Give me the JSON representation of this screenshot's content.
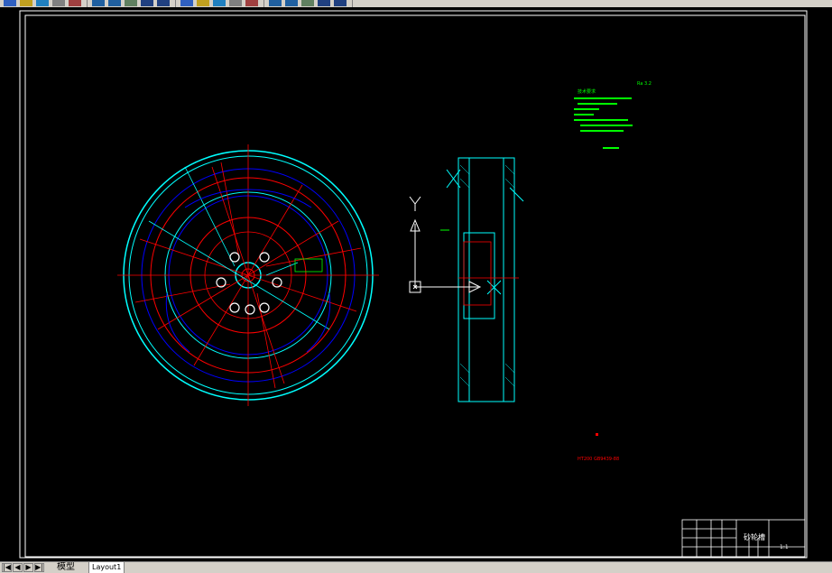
{
  "toolbar": {
    "buttons": [
      "qnew-icon",
      "open-icon",
      "save-icon",
      "print-icon",
      "preview-icon",
      "undo-icon",
      "redo-icon",
      "pan-icon",
      "zoom-icon",
      "zoom-window-icon",
      "zoom-previous-icon",
      "properties-icon",
      "design-center-icon",
      "tool-palettes-icon",
      "sheet-set-icon",
      "markup-icon",
      "calc-icon",
      "layer-icon",
      "color-icon",
      "linetype-icon"
    ]
  },
  "tabs": {
    "nav_buttons": [
      "|◀",
      "◀",
      "▶",
      "▶|"
    ],
    "model_label": "模型",
    "layout_label": "Layout1"
  },
  "drawing": {
    "colors": {
      "background": "#000000",
      "frame": "#ffffff",
      "cyan": "#00ffff",
      "red": "#ff0000",
      "blue": "#0000ff",
      "green": "#00ff00",
      "white": "#ffffff"
    },
    "title_block": {
      "name": "砂轮槽",
      "scale_label": "1:1"
    },
    "material_note": "HT200 GB9439-88",
    "ucs_axis_label": "Y",
    "tech_req_heading": "技术要求",
    "tech_req_label": "Ra 3.2"
  }
}
